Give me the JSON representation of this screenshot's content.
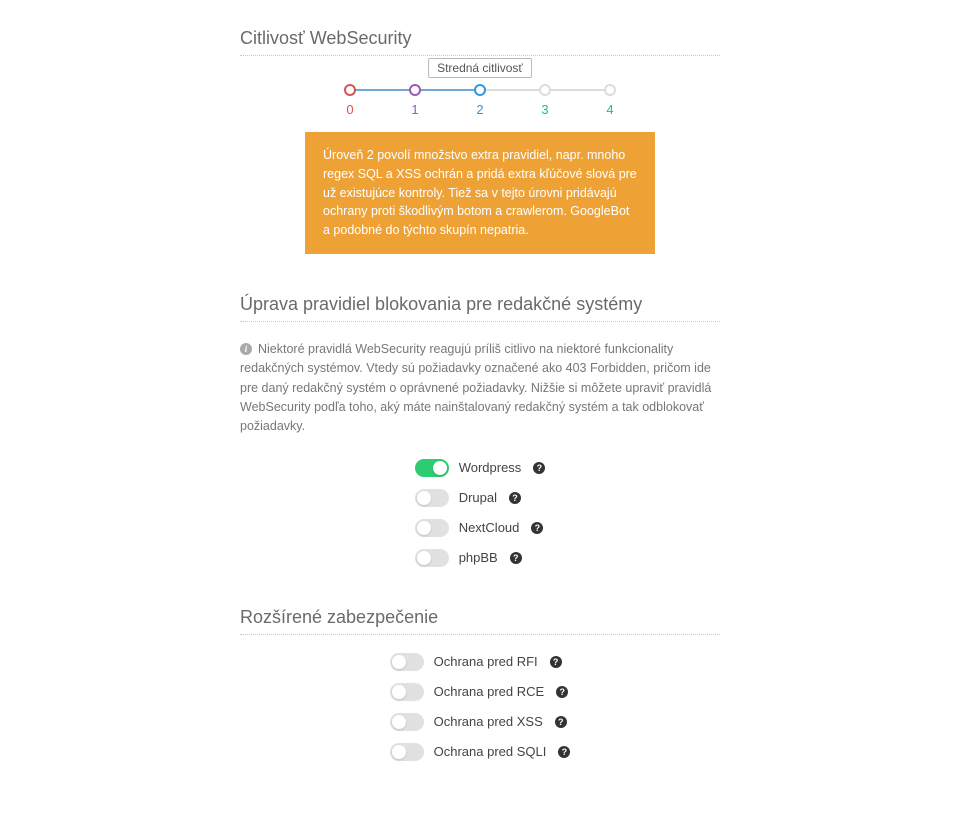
{
  "sensitivity": {
    "title": "Citlivosť WebSecurity",
    "tooltip": "Stredná citlivosť",
    "selected_index": 2,
    "levels": [
      {
        "label": "0",
        "color": "#d9534f"
      },
      {
        "label": "1",
        "color": "#9b59b6"
      },
      {
        "label": "2",
        "color": "#3498db"
      },
      {
        "label": "3",
        "color": "#1abc9c"
      },
      {
        "label": "4",
        "color": "#1abc9c"
      }
    ],
    "description": "Úroveň 2 povolí množstvo extra pravidiel, napr. mnoho regex SQL a XSS ochrán a pridá extra kľúčové slová pre už existujúce kontroly. Tiež sa v tejto úrovni pridávajú ochrany proti škodlivým botom a crawlerom. GoogleBot a podobné do týchto skupín nepatria."
  },
  "cms": {
    "title": "Úprava pravidiel blokovania pre redakčné systémy",
    "notice": "Niektoré pravidlá WebSecurity reagujú príliš citlivo na niektoré funkcionality redakčných systémov. Vtedy sú požiadavky označené ako 403 Forbidden, pričom ide pre daný redakčný systém o oprávnené požiadavky. Nižšie si môžete upraviť pravidlá WebSecurity podľa toho, aký máte nainštalovaný redakčný systém a tak odblokovať požiadavky.",
    "items": [
      {
        "label": "Wordpress",
        "on": true
      },
      {
        "label": "Drupal",
        "on": false
      },
      {
        "label": "NextCloud",
        "on": false
      },
      {
        "label": "phpBB",
        "on": false
      }
    ]
  },
  "advanced": {
    "title": "Rozšírené zabezpečenie",
    "items": [
      {
        "label": "Ochrana pred RFI",
        "on": false
      },
      {
        "label": "Ochrana pred RCE",
        "on": false
      },
      {
        "label": "Ochrana pred XSS",
        "on": false
      },
      {
        "label": "Ochrana pred SQLI",
        "on": false
      }
    ]
  }
}
